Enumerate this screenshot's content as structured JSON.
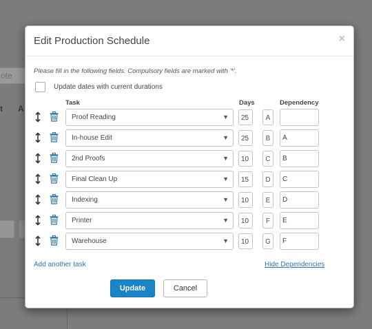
{
  "background": {
    "input_fragment": "ote",
    "header_fragment_1": "t",
    "header_fragment_2": "A"
  },
  "modal": {
    "title": "Edit Production Schedule",
    "close_glyph": "×",
    "instructions": "Please fill in the following fields. Compulsory fields are marked with '*'.",
    "update_dates_label": "Update dates with current durations",
    "update_dates_checked": false,
    "columns": {
      "task": "Task",
      "days": "Days",
      "dependency": "Dependency"
    },
    "tasks": [
      {
        "task": "Proof Reading",
        "days": "25",
        "letter": "A",
        "dependency": ""
      },
      {
        "task": "In-house Edit",
        "days": "25",
        "letter": "B",
        "dependency": "A"
      },
      {
        "task": "2nd Proofs",
        "days": "10",
        "letter": "C",
        "dependency": "B"
      },
      {
        "task": "Final Clean Up",
        "days": "15",
        "letter": "D",
        "dependency": "C"
      },
      {
        "task": "Indexing",
        "days": "10",
        "letter": "E",
        "dependency": "D"
      },
      {
        "task": "Printer",
        "days": "10",
        "letter": "F",
        "dependency": "E"
      },
      {
        "task": "Warehouse",
        "days": "10",
        "letter": "G",
        "dependency": "F"
      }
    ],
    "caret_glyph": "▼",
    "add_task_label": "Add another task",
    "hide_dependencies_label": "Hide Dependencies",
    "update_label": "Update",
    "cancel_label": "Cancel"
  },
  "colors": {
    "accent": "#1a84c7",
    "link": "#2c78b5",
    "overlay": "#7c7c7c"
  },
  "icons": {
    "drag": "drag-handle-icon",
    "delete": "trash-icon",
    "caret": "chevron-down-icon",
    "close": "close-icon"
  }
}
